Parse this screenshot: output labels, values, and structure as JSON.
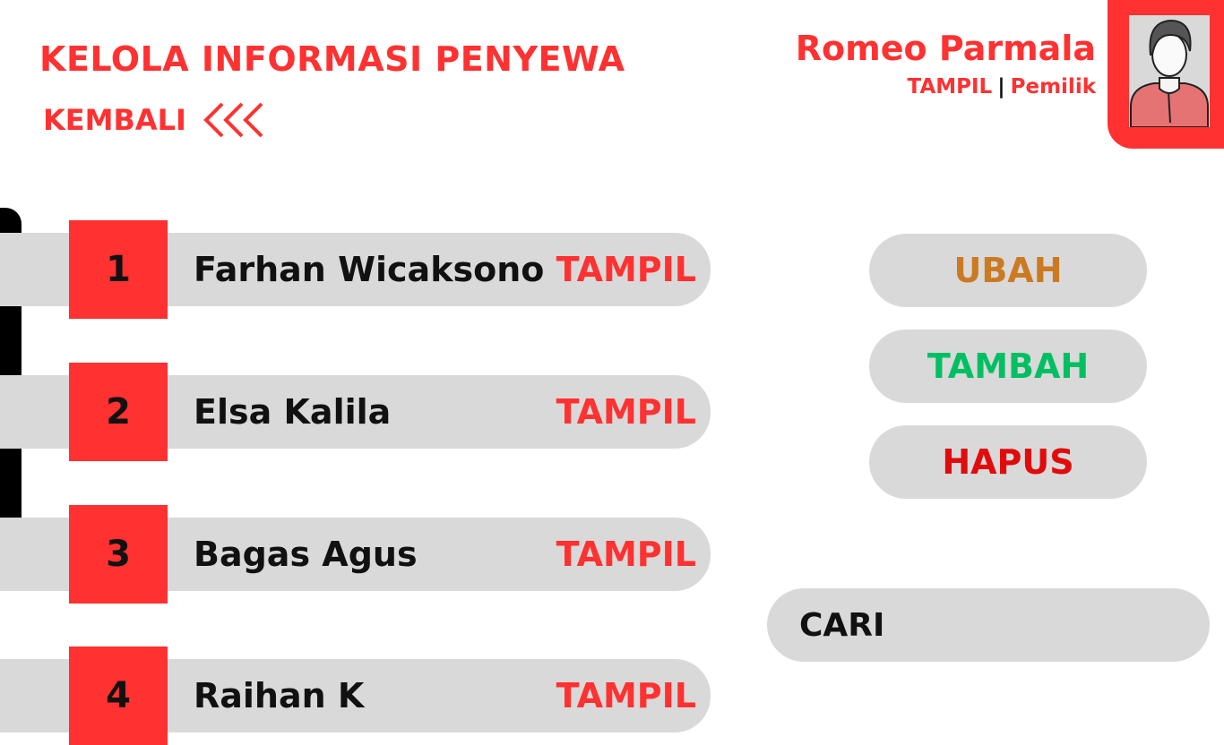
{
  "header": {
    "title": "KELOLA INFORMASI PENYEWA",
    "back_label": "KEMBALI",
    "back_icon": "triple-chevron-left-icon"
  },
  "user": {
    "name": "Romeo Parmala",
    "show_link": "TAMPIL",
    "separator": "|",
    "role": "Pemilik",
    "avatar_icon": "user-avatar-icon"
  },
  "tenants": [
    {
      "number": "1",
      "name": "Farhan Wicaksono",
      "action": "TAMPIL"
    },
    {
      "number": "2",
      "name": "Elsa Kalila",
      "action": "TAMPIL"
    },
    {
      "number": "3",
      "name": "Bagas Agus",
      "action": "TAMPIL"
    },
    {
      "number": "4",
      "name": "Raihan K",
      "action": "TAMPIL"
    }
  ],
  "actions": {
    "edit": "UBAH",
    "add": "TAMBAH",
    "delete": "HAPUS"
  },
  "search": {
    "label": "CARI"
  },
  "colors": {
    "accent": "#ff3131",
    "pill": "#d9d9d9",
    "edit": "#cc7a22",
    "add": "#00bf63",
    "delete": "#e10b0b"
  }
}
